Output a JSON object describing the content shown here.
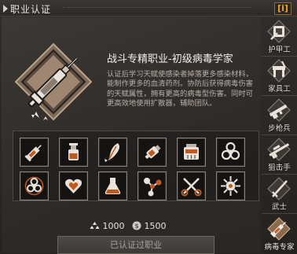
{
  "window": {
    "title": "职业认证"
  },
  "header": {
    "info_label": "i"
  },
  "job": {
    "title": "战斗专精职业-初级病毒学家",
    "description": "认证后学习天赋使感染者掉落更多感染材料，能制作更多的血清药剂。协防后获得病毒伤害的天赋属性，拥有更高的病毒型伤害。同时可更高效地使用扩散器，辅助团队。"
  },
  "skills": {
    "row1": [
      "syringe-icon",
      "serum-bottle-icon",
      "feather-pen-icon",
      "spray-can-icon",
      "pill-bottle-icon",
      "biohazard-icon"
    ],
    "row2": [
      "biohazard-mark-icon",
      "heart-box-icon",
      "flask-icon",
      "molecule-icon",
      "scissors-icon",
      "virus-icon"
    ]
  },
  "cost": {
    "items": [
      {
        "icon": "certificate-icon",
        "value": "1000"
      },
      {
        "icon": "coin-icon",
        "value": "1500"
      }
    ]
  },
  "actions": {
    "certified_label": "已认证过职业"
  },
  "sidebar": {
    "items": [
      {
        "label": "护甲工",
        "icon": "armor-craft-icon",
        "active": false
      },
      {
        "label": "家具工",
        "icon": "furniture-craft-icon",
        "active": false
      },
      {
        "label": "步枪兵",
        "icon": "rifle-icon",
        "active": false
      },
      {
        "label": "狙击手",
        "icon": "sniper-icon",
        "active": false
      },
      {
        "label": "武士",
        "icon": "katana-icon",
        "active": false
      },
      {
        "label": "病毒专家",
        "icon": "virus-syringe-icon",
        "active": true
      }
    ]
  },
  "colors": {
    "accent": "#f0a030",
    "frame": "#8a837d",
    "emblem": "#9a8470"
  }
}
